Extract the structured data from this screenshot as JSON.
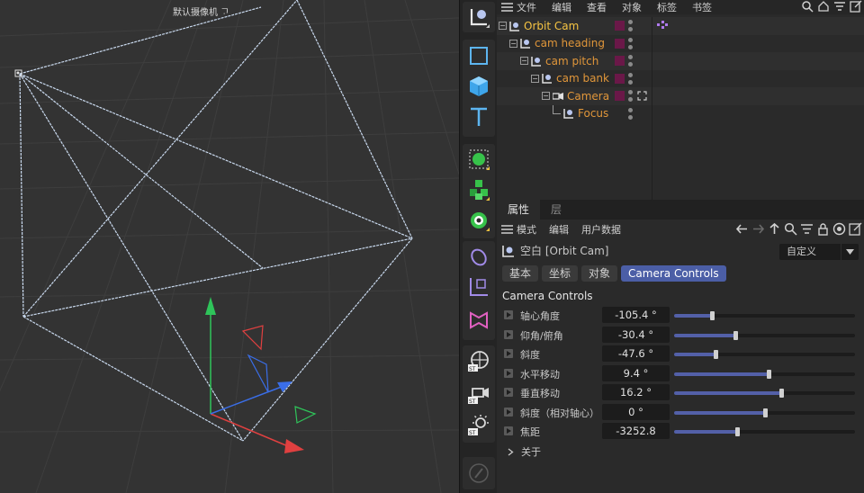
{
  "viewport": {
    "camera_label": "默认摄像机 ",
    "camera_icon": "camera-glyph"
  },
  "toolbar": {
    "tools": [
      {
        "name": "null-object-tool",
        "icon": "null-axis-icon"
      },
      {
        "name": "plane-tool",
        "icon": "square-icon"
      },
      {
        "name": "cube-tool",
        "icon": "cube-icon"
      },
      {
        "name": "text-tool",
        "icon": "text-icon"
      },
      {
        "name": "subdivision-tool",
        "icon": "green-sphere-icon"
      },
      {
        "name": "cloner-tool",
        "icon": "green-cubes-icon"
      },
      {
        "name": "deformer-tool",
        "icon": "gear-flower-icon"
      },
      {
        "name": "spline-tool",
        "icon": "pen-icon"
      },
      {
        "name": "field-tool",
        "icon": "axis-cube-icon"
      },
      {
        "name": "scene-tool",
        "icon": "pink-fold-icon"
      },
      {
        "name": "sky-tool",
        "icon": "globe-st-icon"
      },
      {
        "name": "camera-tool",
        "icon": "camera-st-icon"
      },
      {
        "name": "light-tool",
        "icon": "light-st-icon"
      },
      {
        "name": "edit-tool",
        "icon": "edit-icon"
      }
    ]
  },
  "object_manager": {
    "menu": [
      "文件",
      "编辑",
      "查看",
      "对象",
      "标签",
      "书签"
    ],
    "tree": [
      {
        "label": "Orbit Cam",
        "depth": 0,
        "expander": "⊟",
        "selected": true
      },
      {
        "label": "cam heading",
        "depth": 1,
        "expander": "⊟",
        "selected": false
      },
      {
        "label": "cam pitch",
        "depth": 2,
        "expander": "⊟",
        "selected": false
      },
      {
        "label": "cam bank",
        "depth": 3,
        "expander": "⊟",
        "selected": false
      },
      {
        "label": "Camera",
        "depth": 4,
        "expander": "⊟",
        "selected": false
      },
      {
        "label": "Focus",
        "depth": 5,
        "expander": "",
        "selected": false
      }
    ]
  },
  "attributes": {
    "tabs": [
      "属性",
      "层"
    ],
    "menu": [
      "模式",
      "编辑",
      "用户数据"
    ],
    "title": "空白 [Orbit Cam]",
    "preset": "自定义",
    "subtabs": [
      "基本",
      "坐标",
      "对象",
      "Camera Controls"
    ],
    "section_title": "Camera Controls",
    "params": [
      {
        "label": "轴心角度",
        "value": "-105.4 °",
        "fill": 0.21
      },
      {
        "label": "仰角/俯角",
        "value": "-30.4 °",
        "fill": 0.34
      },
      {
        "label": "斜度",
        "value": "-47.6 °",
        "fill": 0.23
      },
      {
        "label": "水平移动",
        "value": "9.4 °",
        "fill": 0.52
      },
      {
        "label": "垂直移动",
        "value": "16.2 °",
        "fill": 0.59
      },
      {
        "label": "斜度（相对轴心）",
        "value": "0 °",
        "fill": 0.5
      },
      {
        "label": "焦距",
        "value": "-3252.8",
        "fill": 0.35
      }
    ],
    "about": "关于"
  },
  "colors": {
    "accent": "#4b5ea6",
    "tree_orange": "#e0963a",
    "tree_selected": "#f6c443",
    "layer_swatch": "#6a1848"
  }
}
